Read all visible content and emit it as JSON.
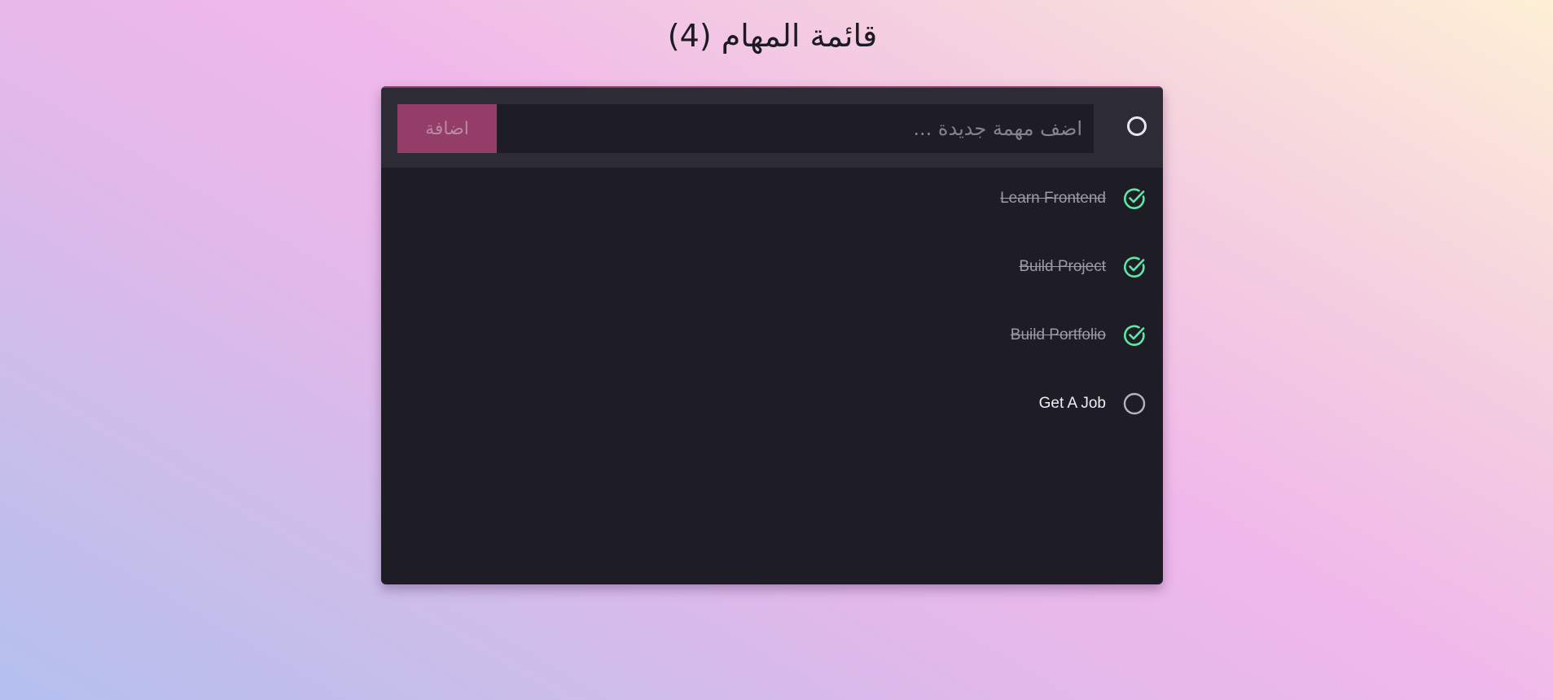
{
  "page": {
    "title": "قائمة المهام (4)"
  },
  "header": {
    "input_placeholder": "اضف مهمة جديدة ...",
    "input_value": "",
    "add_label": "اضافة"
  },
  "tasks": [
    {
      "label": "Learn Frontend",
      "completed": true
    },
    {
      "label": "Build Project",
      "completed": true
    },
    {
      "label": "Build Portfolio",
      "completed": true
    },
    {
      "label": "Get A Job",
      "completed": false
    }
  ],
  "icons": {
    "header_toggle": "circle-icon",
    "completed": "check-circle-icon",
    "pending": "circle-icon"
  },
  "colors": {
    "accent": "#943d68",
    "check": "#5ee8a8",
    "card": "#1e1d25",
    "header": "#2d2b36"
  }
}
